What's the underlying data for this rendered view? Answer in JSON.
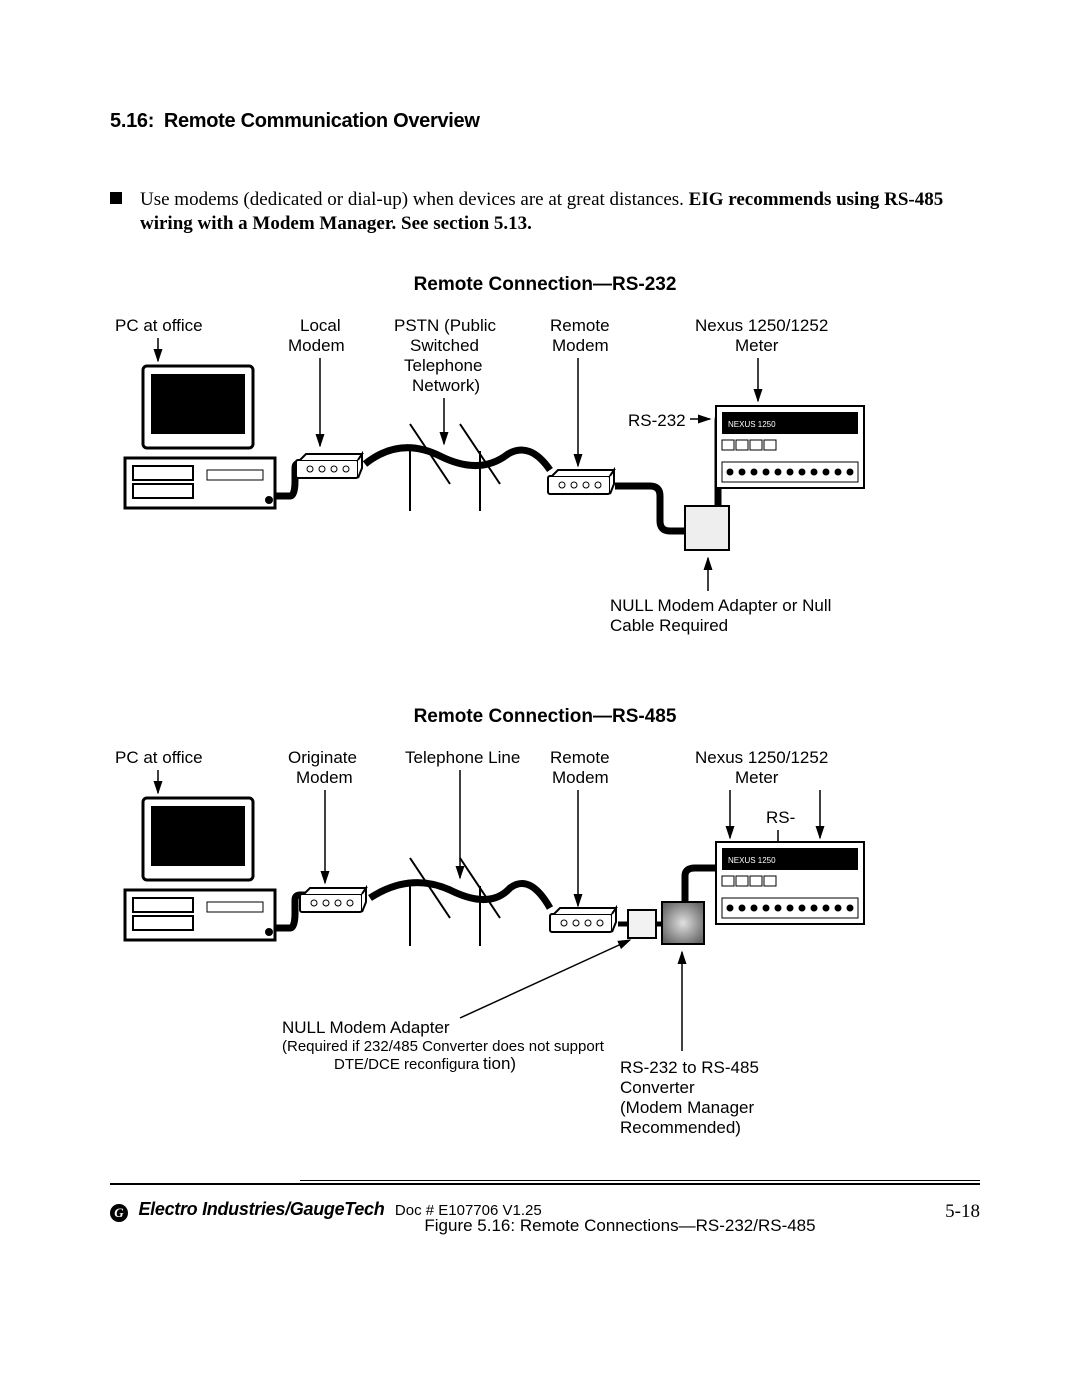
{
  "section_number": "5.16:",
  "section_title": "Remote Communication Overview",
  "body": {
    "regular": "Use modems (dedicated or dial-up) when devices are at great distances. ",
    "bold": "EIG recommends using RS-485 wiring with a Modem Manager. See section 5.13."
  },
  "diagram1": {
    "title": "Remote Connection—RS-232",
    "labels": {
      "pc": "PC at office",
      "local_modem_l1": "Local",
      "local_modem_l2": "Modem",
      "pstn_l1": "PSTN (Public",
      "pstn_l2": "Switched",
      "pstn_l3": "Telephone",
      "pstn_l4": "Network)",
      "remote_modem_l1": "Remote",
      "remote_modem_l2": "Modem",
      "nexus_l1": "Nexus 1250/1252",
      "nexus_l2": "Meter",
      "port_label": "RS-232",
      "null_l1": "NULL Modem Adapter or Null",
      "null_l2": "Cable Required"
    }
  },
  "diagram2": {
    "title": "Remote Connection—RS-485",
    "labels": {
      "pc": "PC at office",
      "orig_l1": "Originate",
      "orig_l2": "Modem",
      "tel_line": "Telephone Line",
      "remote_modem_l1": "Remote",
      "remote_modem_l2": "Modem",
      "nexus_l1": "Nexus 1250/1252",
      "nexus_l2": "Meter",
      "port_label": "RS-",
      "null_l1": "NULL Modem Adapter",
      "null_l2": "(Required if 232/485 Converter does not support",
      "null_l3": "DTE/DCE reconfiguration)",
      "null_suffix": "tion)",
      "null_l3_prefix": "DTE/DCE reconfigura",
      "conv_l1": "RS-232 to RS-485",
      "conv_l2": "Converter",
      "conv_l3": "(Modem Manager",
      "conv_l4": "Recommended)"
    }
  },
  "caption": "Figure 5.16: Remote Connections—RS-232/RS-485",
  "footer": {
    "company": "Electro Industries/GaugeTech",
    "doc": "Doc # E107706   V1.25",
    "page": "5-18",
    "logo": "G"
  }
}
